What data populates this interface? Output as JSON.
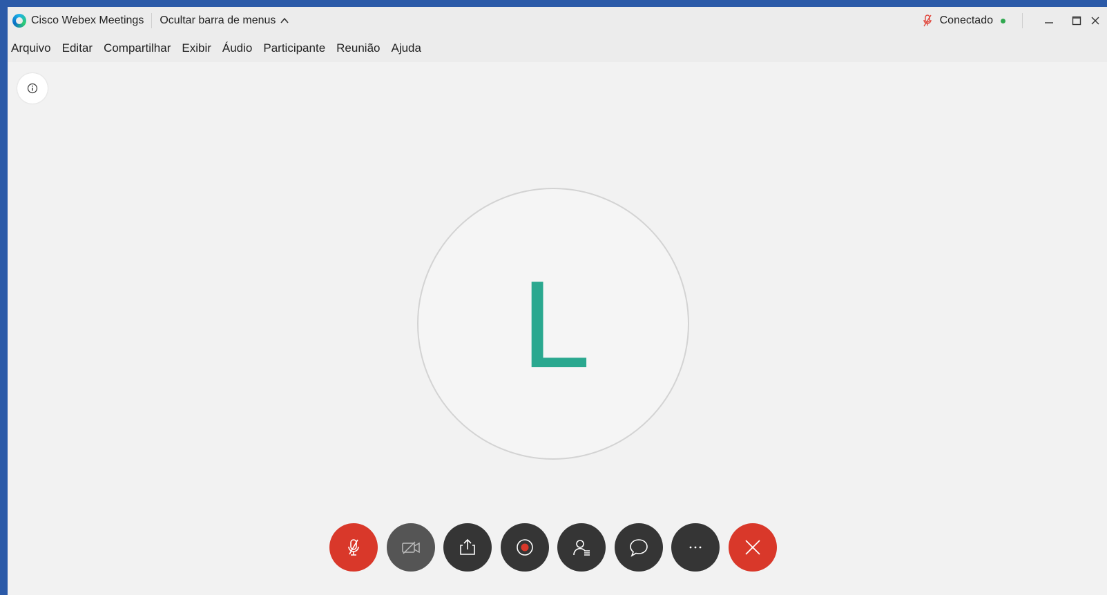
{
  "titlebar": {
    "app_title": "Cisco Webex Meetings",
    "hide_menu_label": "Ocultar barra de menus",
    "connection_status": "Conectado"
  },
  "menu": {
    "items": [
      "Arquivo",
      "Editar",
      "Compartilhar",
      "Exibir",
      "Áudio",
      "Participante",
      "Reunião",
      "Ajuda"
    ]
  },
  "avatar": {
    "initial": "L",
    "color": "#2aa88f"
  },
  "controls": {
    "icons": [
      "mic-muted-icon",
      "video-off-icon",
      "share-icon",
      "record-icon",
      "participants-icon",
      "chat-icon",
      "more-icon",
      "leave-icon"
    ]
  },
  "colors": {
    "danger": "#d9382a",
    "control_bg": "#353535",
    "status_green": "#2fa84f",
    "desktop": "#2b5aa8"
  }
}
